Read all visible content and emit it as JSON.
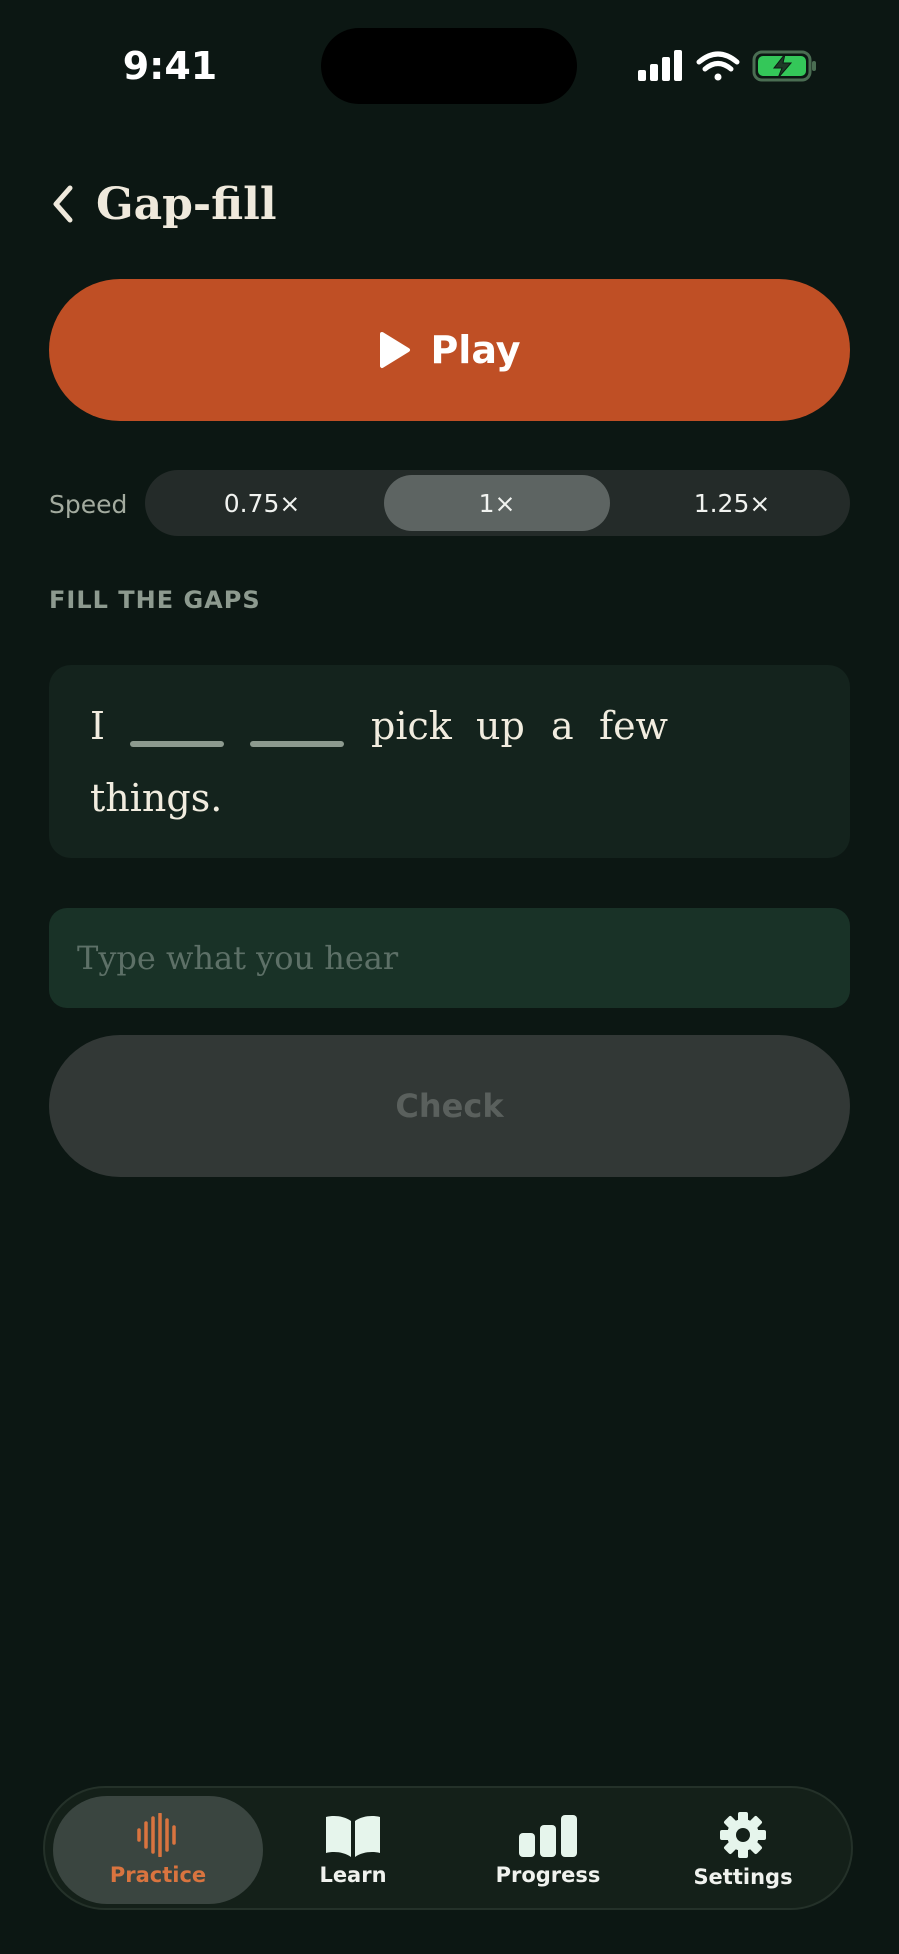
{
  "status_bar": {
    "time": "9:41"
  },
  "header": {
    "title": "Gap-fill",
    "back_icon": "chevron-left-icon"
  },
  "player": {
    "play_label": "Play",
    "play_icon": "play-icon",
    "accent_color": "#bf4f25"
  },
  "speed": {
    "label": "Speed",
    "options": [
      "0.75×",
      "1×",
      "1.25×"
    ],
    "selected": "1×"
  },
  "exercise": {
    "section_label": "FILL THE GAPS",
    "words": [
      "I",
      "pick",
      "up",
      "a",
      "few",
      "things."
    ],
    "gap_count": 2
  },
  "answer": {
    "placeholder": "Type what you hear",
    "value": ""
  },
  "check": {
    "label": "Check"
  },
  "tab_bar": {
    "items": [
      {
        "label": "Practice",
        "icon": "waveform-icon",
        "active": true
      },
      {
        "label": "Learn",
        "icon": "open-book-icon",
        "active": false
      },
      {
        "label": "Progress",
        "icon": "bar-chart-icon",
        "active": false
      },
      {
        "label": "Settings",
        "icon": "gear-icon",
        "active": false
      }
    ],
    "active_color": "#d9743f"
  }
}
